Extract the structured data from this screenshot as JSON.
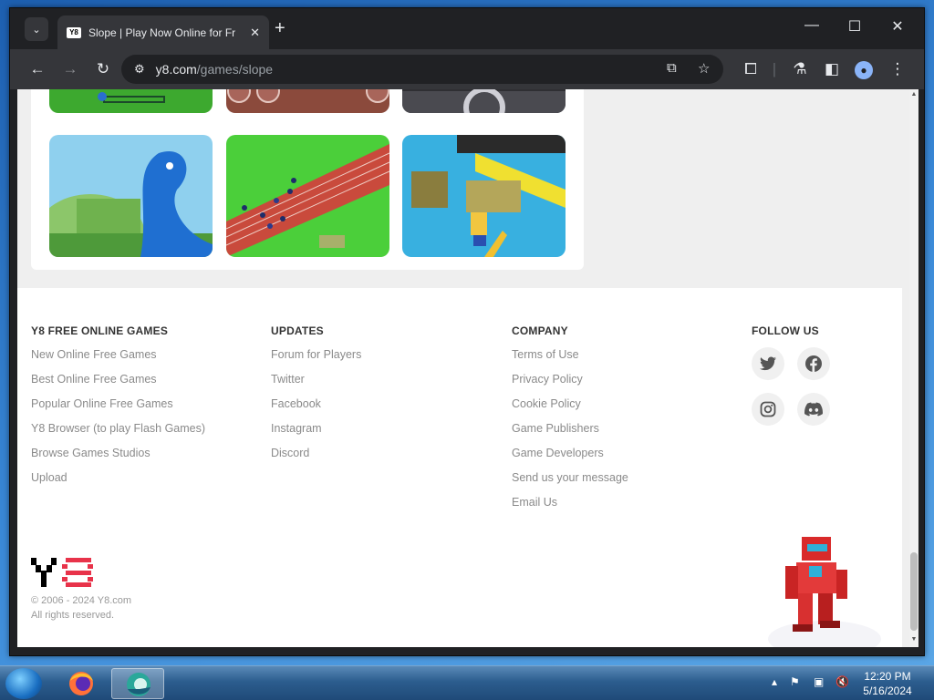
{
  "browser": {
    "tab_title": "Slope | Play Now Online for Fr",
    "favicon_text": "Y8",
    "url_host": "y8.com",
    "url_path": "/games/slope",
    "controls": {
      "minimize": "—",
      "maximize": "☐",
      "close": "✕"
    }
  },
  "footer": {
    "columns": [
      {
        "heading": "Y8 FREE ONLINE GAMES",
        "links": [
          "New Online Free Games",
          "Best Online Free Games",
          "Popular Online Free Games",
          "Y8 Browser (to play Flash Games)",
          "Browse Games Studios",
          "Upload"
        ]
      },
      {
        "heading": "UPDATES",
        "links": [
          "Forum for Players",
          "Twitter",
          "Facebook",
          "Instagram",
          "Discord"
        ]
      },
      {
        "heading": "COMPANY",
        "links": [
          "Terms of Use",
          "Privacy Policy",
          "Cookie Policy",
          "Game Publishers",
          "Game Developers",
          "Send us your message",
          "Email Us"
        ]
      },
      {
        "heading": "FOLLOW US",
        "links": []
      }
    ],
    "social_icons": [
      "twitter-icon",
      "facebook-icon",
      "instagram-icon",
      "discord-icon"
    ],
    "copyright_line1": "© 2006 - 2024 Y8.com",
    "copyright_line2": "All rights reserved."
  },
  "taskbar": {
    "time": "12:20 PM",
    "date": "5/16/2024"
  },
  "colors": {
    "brand_red": "#e8334a",
    "link_gray": "#8a8a8a",
    "page_bg": "#efefef"
  }
}
